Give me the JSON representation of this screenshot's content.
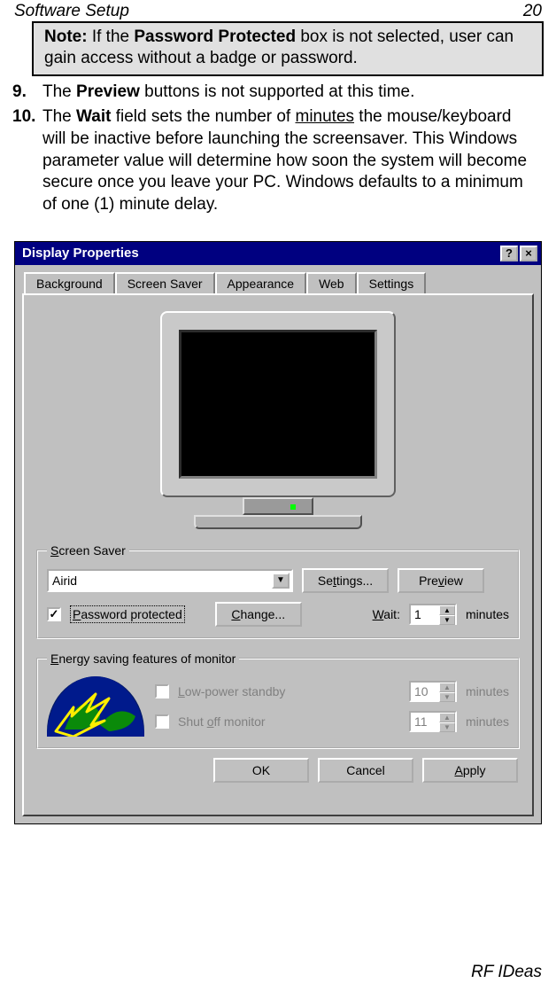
{
  "header": {
    "section": "Software Setup",
    "page": "20"
  },
  "note": {
    "label": "Note:",
    "text_a": " If the ",
    "bold": "Password Protected",
    "text_b": " box is not selected, user can gain access without a badge or password."
  },
  "steps": {
    "s9": {
      "num": "9.",
      "a": "The ",
      "preview": "Preview",
      "b": " buttons is not supported at this time."
    },
    "s10": {
      "num": "10.",
      "a": "The ",
      "wait": "Wait",
      "b": " field sets the number of ",
      "minutes": "minutes",
      "c": " the mouse/keyboard will be inactive before launching the screensaver.  This Windows parameter value will determine how soon the system will become secure once you leave your PC. Windows defaults to a minimum of one (1) minute delay."
    }
  },
  "dialog": {
    "title": "Display Properties",
    "help_btn": "?",
    "close_btn": "×",
    "tabs": {
      "bg": "Background",
      "ss": "Screen Saver",
      "ap": "Appearance",
      "web": "Web",
      "set": "Settings"
    },
    "group_ss": {
      "legend_s": "S",
      "legend_rest": "creen Saver",
      "selected": "Airid",
      "settings_btn_pre": "Se",
      "settings_btn_accel": "t",
      "settings_btn_post": "tings...",
      "preview_btn_pre": "Pre",
      "preview_btn_accel": "v",
      "preview_btn_post": "iew",
      "pw_checked": "✓",
      "pw_label_accel": "P",
      "pw_label_rest": "assword protected",
      "change_btn_accel": "C",
      "change_btn_rest": "hange...",
      "wait_label_accel": "W",
      "wait_label_rest": "ait:",
      "wait_value": "1",
      "minutes": "minutes"
    },
    "group_energy": {
      "legend_accel": "E",
      "legend_rest": "nergy saving features of monitor",
      "lp_accel": "L",
      "lp_rest": "ow-power standby",
      "lp_value": "10",
      "lp_minutes": "minutes",
      "so_pre": "Shut ",
      "so_accel": "o",
      "so_post": "ff monitor",
      "so_value": "11",
      "so_minutes": "minutes"
    },
    "buttons": {
      "ok": "OK",
      "cancel": "Cancel",
      "apply_accel": "A",
      "apply_rest": "pply"
    }
  },
  "footer": "RF IDeas"
}
